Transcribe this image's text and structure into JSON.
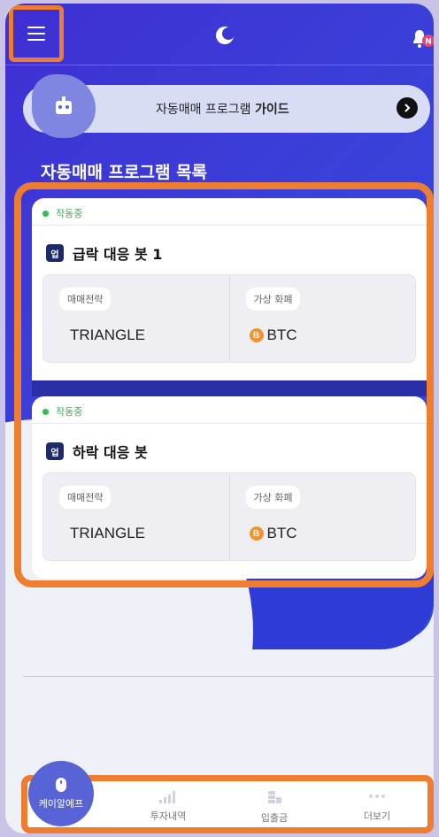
{
  "header": {
    "menu_icon": "hamburger-icon",
    "logo_icon": "crescent-logo-icon",
    "notification_icon": "bell-icon",
    "badge": "N"
  },
  "guide": {
    "text_prefix": "자동매매 프로그램 ",
    "text_bold": "가이드",
    "icon": "robot-icon"
  },
  "section_title": "자동매매 프로그램 목록",
  "bots": [
    {
      "status": "작동중",
      "badge": "업",
      "name": "급락 대응 봇 1",
      "strategy_label": "매매전략",
      "strategy": "TRIANGLE",
      "currency_label": "가상 화폐",
      "currency": "BTC"
    },
    {
      "status": "작동중",
      "badge": "업",
      "name": "하락 대응 봇",
      "strategy_label": "매매전략",
      "strategy": "TRIANGLE",
      "currency_label": "가상 화폐",
      "currency": "BTC"
    }
  ],
  "nav": {
    "home": "케이알에프",
    "items": [
      {
        "label": "투자내역"
      },
      {
        "label": "입출금"
      },
      {
        "label": "더보기"
      }
    ]
  },
  "colors": {
    "accent": "#3f2fd4",
    "highlight": "#ef7d2f",
    "active": "#2fbf4f"
  }
}
